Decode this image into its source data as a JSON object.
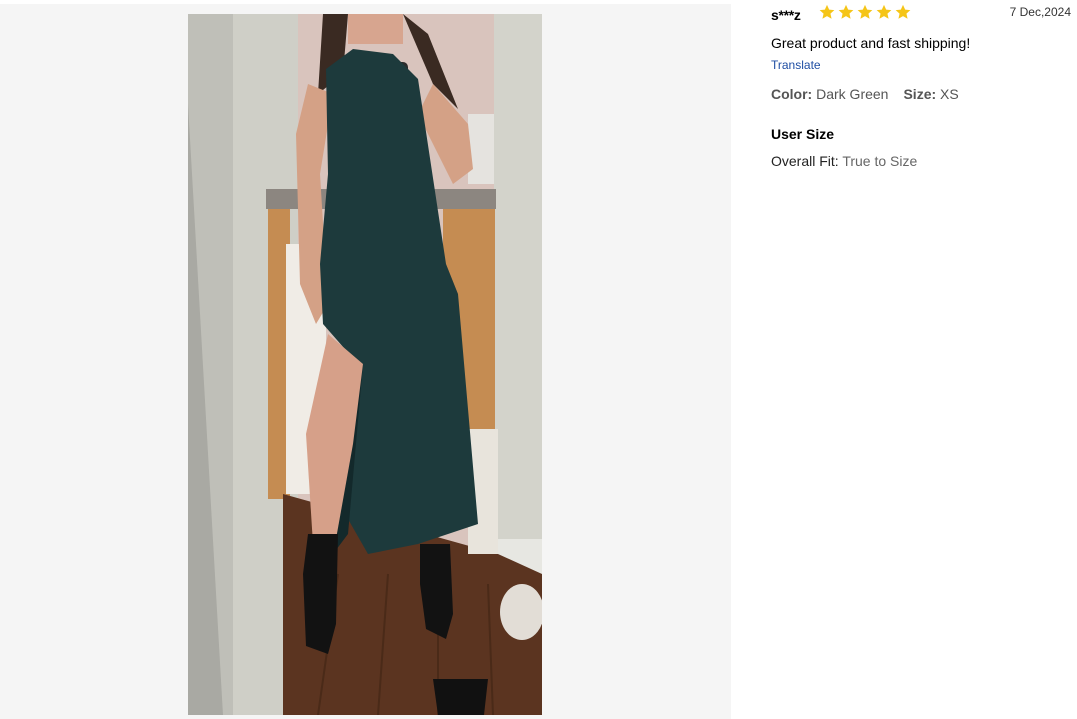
{
  "review": {
    "username": "s***z",
    "rating": 5,
    "date": "7 Dec,2024",
    "text": "Great product and fast shipping!",
    "translate_label": "Translate",
    "attributes": [
      {
        "label": "Color:",
        "value": "Dark Green"
      },
      {
        "label": "Size:",
        "value": "XS"
      }
    ],
    "user_size_title": "User Size",
    "fit_label": "Overall Fit:",
    "fit_value": "True to Size"
  },
  "colors": {
    "star": "#f5c518",
    "link": "#1f4ea3",
    "panel_bg": "#f5f5f5",
    "dress": "#1d3a3c",
    "floor": "#5b3420"
  },
  "icons": {
    "star": "star-icon"
  }
}
